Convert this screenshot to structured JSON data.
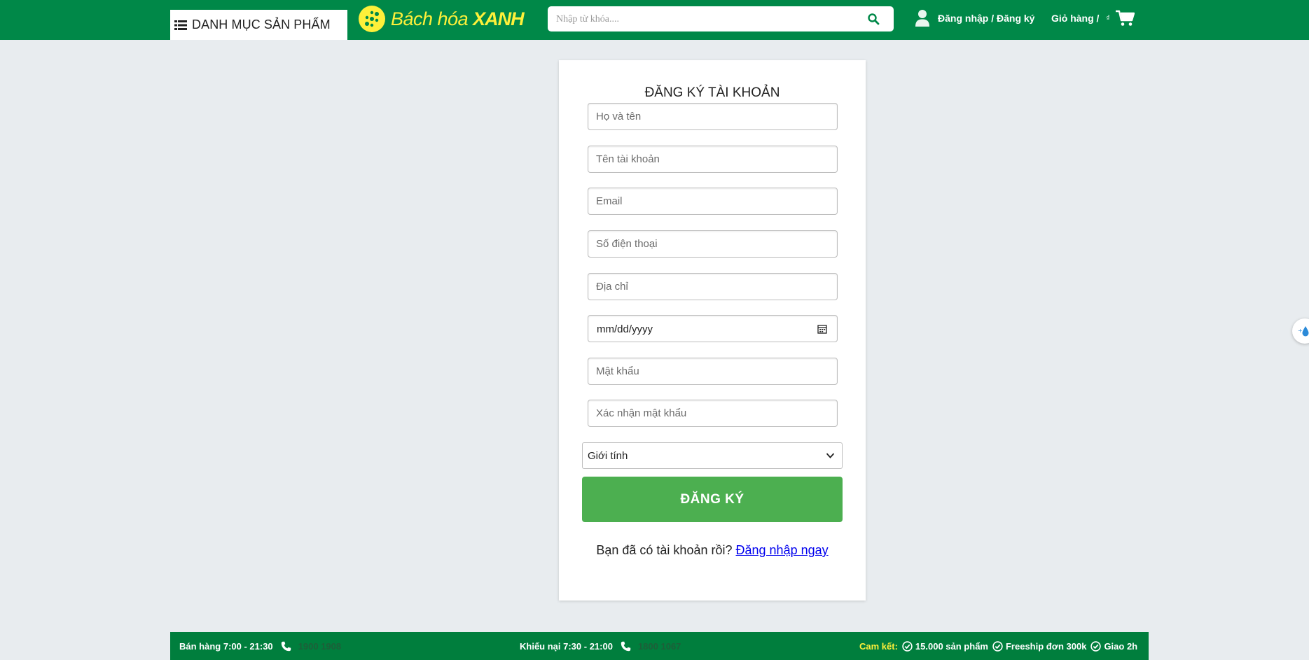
{
  "header": {
    "category_label": "DANH MỤC SẢN PHẨM",
    "logo_text_1": "Bách hóa",
    "logo_text_2": "XANH",
    "search_placeholder": "Nhập từ khóa....",
    "account_label": "Đăng nhập / Đăng ký",
    "cart_label": "Giỏ hàng /",
    "cart_total": "₫"
  },
  "form": {
    "title": "ĐĂNG KÝ TÀI KHOẢN",
    "fullname_placeholder": "Họ và tên",
    "username_placeholder": "Tên tài khoản",
    "email_placeholder": "Email",
    "phone_placeholder": "Số điện thoại",
    "address_placeholder": "Địa chỉ",
    "dob_value": "mm/dd/yyyy",
    "password_placeholder": "Mật khẩu",
    "confirm_placeholder": "Xác nhận mật khẩu",
    "gender_value": "Giới tính",
    "submit_label": "ĐĂNG KÝ",
    "have_account_text": "Bạn đã có tài khoản rồi?",
    "login_link": "Đăng nhập ngay"
  },
  "footer": {
    "sales_hours": "Bán hàng 7:00 - 21:30",
    "sales_phone": "1900 1908",
    "complaint_hours": "Khiếu nại 7:30 - 21:00",
    "complaint_phone": "1800 1067",
    "commit_label": "Cam kết:",
    "commit_1": "15.000 sản phẩm",
    "commit_2": "Freeship đơn 300k",
    "commit_3": "Giao 2h"
  },
  "colors": {
    "header_green": "#008848",
    "logo_yellow": "#fdf03a",
    "button_green": "#4caf50",
    "footer_green": "#007e3d"
  }
}
